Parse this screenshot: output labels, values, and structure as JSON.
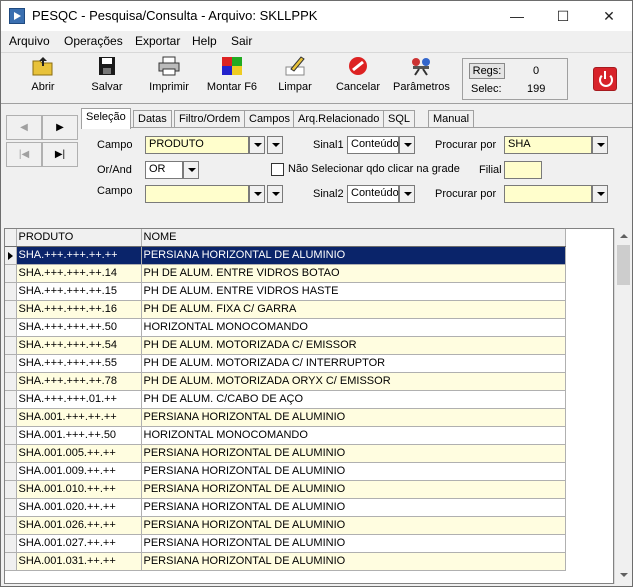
{
  "window": {
    "title": "PESQC  - Pesquisa/Consulta - Arquivo: SKLLPPK",
    "minimize": "—",
    "maximize": "☐",
    "close": "✕"
  },
  "menu": [
    {
      "label": "Arquivo"
    },
    {
      "label": "Operações"
    },
    {
      "label": "Exportar"
    },
    {
      "label": "Help"
    },
    {
      "label": "Sair"
    }
  ],
  "toolbar": {
    "abrir": "Abrir",
    "salvar": "Salvar",
    "imprimir": "Imprimir",
    "montar": "Montar F6",
    "limpar": "Limpar",
    "cancelar": "Cancelar",
    "parametros": "Parâmetros",
    "regs_label": "Regs:",
    "regs_value": "0",
    "selec_label": "Selec:",
    "selec_value": "199"
  },
  "nav": {
    "prev": "◀",
    "next": "▶",
    "first": "|◀",
    "last": "▶|"
  },
  "tabs": [
    "Seleção",
    "Datas",
    "Filtro/Ordem",
    "Campos",
    "Arq.Relacionado",
    "SQL",
    "Manual"
  ],
  "form": {
    "campo_label": "Campo",
    "campo1_value": "PRODUTO",
    "sinal1_label": "Sinal1",
    "sinal1_value": "Conteúdo",
    "procurar1_label": "Procurar por",
    "procurar1_value": "SHA",
    "orand_label": "Or/And",
    "orand_value": "OR",
    "checkbox_label": "Não Selecionar qdo clicar na grade",
    "filial_label": "Filial",
    "filial_value": "",
    "campo2_label": "Campo",
    "campo2_value": "",
    "sinal2_label": "Sinal2",
    "sinal2_value": "Conteúdo",
    "procurar2_label": "Procurar por",
    "procurar2_value": ""
  },
  "grid": {
    "headers": [
      "PRODUTO",
      "NOME"
    ],
    "rows": [
      [
        "SHA.+++.+++.++.++",
        "PERSIANA HORIZONTAL DE ALUMINIO"
      ],
      [
        "SHA.+++.+++.++.14",
        "PH DE ALUM. ENTRE VIDROS BOTAO"
      ],
      [
        "SHA.+++.+++.++.15",
        "PH DE ALUM. ENTRE VIDROS HASTE"
      ],
      [
        "SHA.+++.+++.++.16",
        "PH DE ALUM. FIXA C/ GARRA"
      ],
      [
        "SHA.+++.+++.++.50",
        "HORIZONTAL MONOCOMANDO"
      ],
      [
        "SHA.+++.+++.++.54",
        "PH DE ALUM. MOTORIZADA C/ EMISSOR"
      ],
      [
        "SHA.+++.+++.++.55",
        "PH DE ALUM. MOTORIZADA C/ INTERRUPTOR"
      ],
      [
        "SHA.+++.+++.++.78",
        "PH DE ALUM. MOTORIZADA ORYX C/ EMISSOR"
      ],
      [
        "SHA.+++.+++.01.++",
        "PH DE ALUM. C/CABO DE AÇO"
      ],
      [
        "SHA.001.+++.++.++",
        "PERSIANA HORIZONTAL DE ALUMINIO"
      ],
      [
        "SHA.001.+++.++.50",
        "HORIZONTAL MONOCOMANDO"
      ],
      [
        "SHA.001.005.++.++",
        "PERSIANA HORIZONTAL DE ALUMINIO"
      ],
      [
        "SHA.001.009.++.++",
        "PERSIANA HORIZONTAL DE ALUMINIO"
      ],
      [
        "SHA.001.010.++.++",
        "PERSIANA HORIZONTAL DE ALUMINIO"
      ],
      [
        "SHA.001.020.++.++",
        "PERSIANA HORIZONTAL DE ALUMINIO"
      ],
      [
        "SHA.001.026.++.++",
        "PERSIANA HORIZONTAL DE ALUMINIO"
      ],
      [
        "SHA.001.027.++.++",
        "PERSIANA HORIZONTAL DE ALUMINIO"
      ],
      [
        "SHA.001.031.++.++",
        "PERSIANA HORIZONTAL DE ALUMINIO"
      ]
    ]
  }
}
